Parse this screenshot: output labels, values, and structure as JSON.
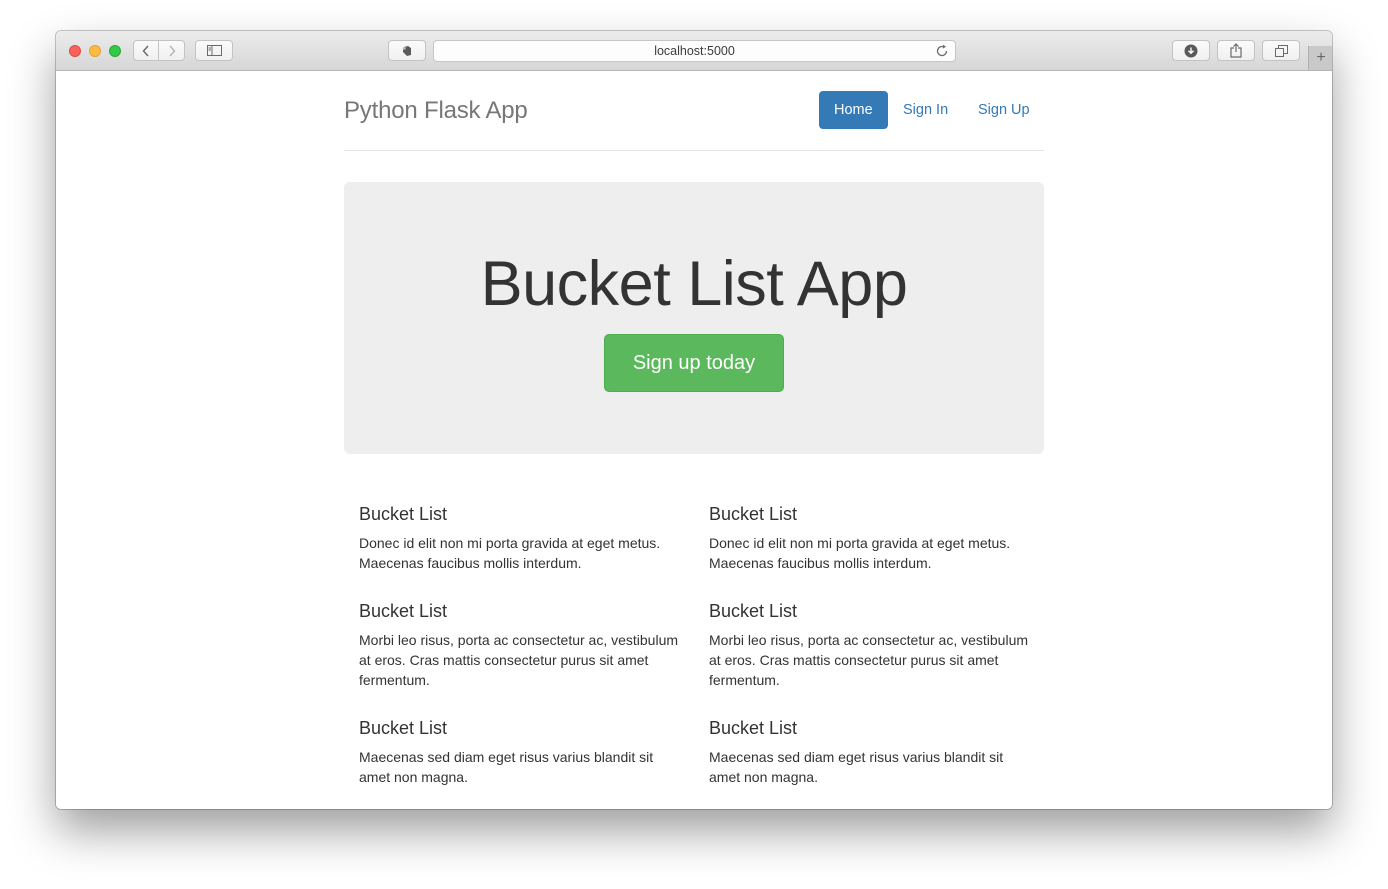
{
  "browser": {
    "url": "localhost:5000",
    "icons": {
      "back": "chevron-left-icon",
      "forward": "chevron-right-icon",
      "sidebar": "sidebar-icon",
      "extension": "evernote-icon",
      "reload": "reload-icon",
      "download": "download-icon",
      "share": "share-icon",
      "tabs": "tabs-icon",
      "new_tab": "+"
    }
  },
  "header": {
    "brand": "Python Flask App",
    "nav": [
      {
        "label": "Home",
        "active": true
      },
      {
        "label": "Sign In",
        "active": false
      },
      {
        "label": "Sign Up",
        "active": false
      }
    ]
  },
  "jumbotron": {
    "title": "Bucket List App",
    "button": "Sign up today"
  },
  "marketing": {
    "left": [
      {
        "title": "Bucket List",
        "text": "Donec id elit non mi porta gravida at eget metus. Maecenas faucibus mollis interdum."
      },
      {
        "title": "Bucket List",
        "text": "Morbi leo risus, porta ac consectetur ac, vestibulum at eros. Cras mattis consectetur purus sit amet fermentum."
      },
      {
        "title": "Bucket List",
        "text": "Maecenas sed diam eget risus varius blandit sit amet non magna."
      }
    ],
    "right": [
      {
        "title": "Bucket List",
        "text": "Donec id elit non mi porta gravida at eget metus. Maecenas faucibus mollis interdum."
      },
      {
        "title": "Bucket List",
        "text": "Morbi leo risus, porta ac consectetur ac, vestibulum at eros. Cras mattis consectetur purus sit amet fermentum."
      },
      {
        "title": "Bucket List",
        "text": "Maecenas sed diam eget risus varius blandit sit amet non magna."
      }
    ]
  },
  "colors": {
    "primary": "#337ab7",
    "success": "#5cb85c",
    "jumbotron_bg": "#eeeeee"
  }
}
